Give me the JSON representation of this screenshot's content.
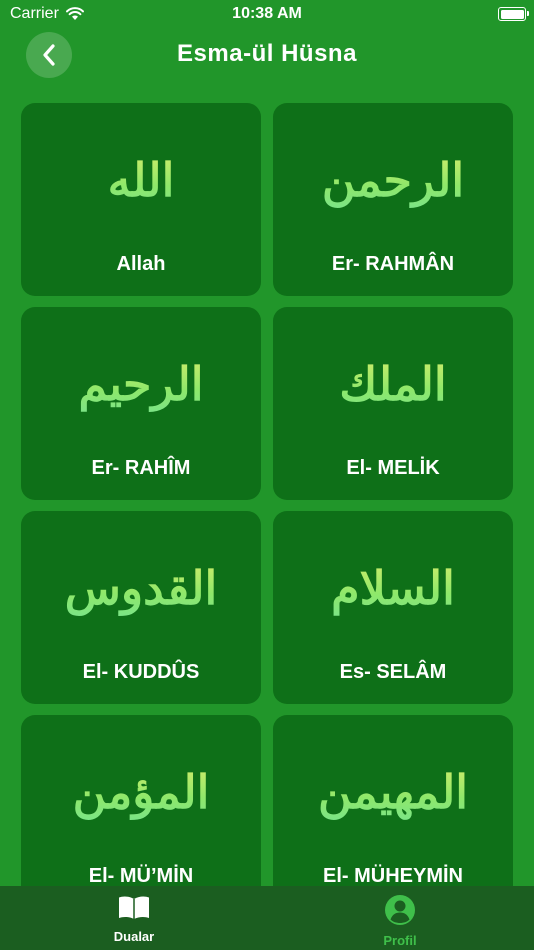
{
  "status": {
    "carrier": "Carrier",
    "time": "10:38 AM"
  },
  "nav": {
    "title": "Esma-ül Hüsna"
  },
  "names": [
    {
      "arabic": "الله",
      "label": "Allah"
    },
    {
      "arabic": "الرحمن",
      "label": "Er- RAHMÂN"
    },
    {
      "arabic": "الرحيم",
      "label": "Er- RAHÎM"
    },
    {
      "arabic": "الملك",
      "label": "El- MELİK"
    },
    {
      "arabic": "القدوس",
      "label": "El- KUDDÛS"
    },
    {
      "arabic": "السلام",
      "label": "Es- SELÂM"
    },
    {
      "arabic": "المؤمن",
      "label": "El- MÜ’MİN"
    },
    {
      "arabic": "المهيمن",
      "label": "El- MÜHEYMİN"
    }
  ],
  "tabs": [
    {
      "label": "Dualar",
      "icon": "book-icon",
      "color": "#ffffff"
    },
    {
      "label": "Profil",
      "icon": "person-icon",
      "color": "#3fbf4a"
    }
  ]
}
